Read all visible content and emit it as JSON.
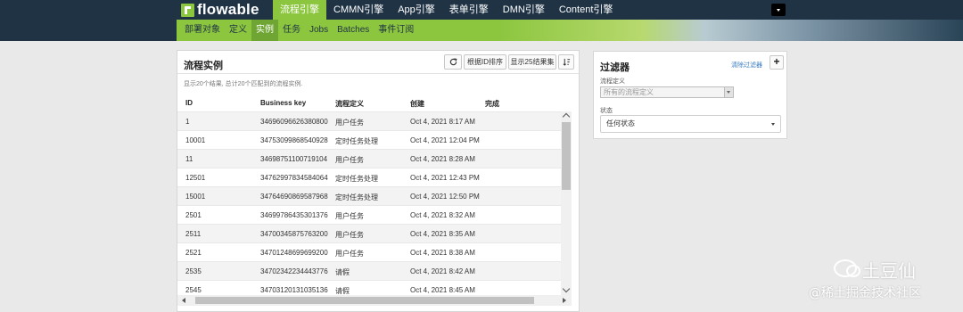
{
  "app": {
    "logo_text": "flowable"
  },
  "topnav": {
    "tabs": [
      {
        "label": "流程引擎",
        "active": true
      },
      {
        "label": "CMMN引擎",
        "active": false
      },
      {
        "label": "App引擎",
        "active": false
      },
      {
        "label": "表单引擎",
        "active": false
      },
      {
        "label": "DMN引擎",
        "active": false
      },
      {
        "label": "Content引擎",
        "active": false
      }
    ]
  },
  "subnav": {
    "tabs": [
      {
        "label": "部署对象",
        "active": false
      },
      {
        "label": "定义",
        "active": false
      },
      {
        "label": "实例",
        "active": true
      },
      {
        "label": "任务",
        "active": false
      },
      {
        "label": "Jobs",
        "active": false
      },
      {
        "label": "Batches",
        "active": false
      },
      {
        "label": "事件订阅",
        "active": false
      }
    ]
  },
  "instances": {
    "title": "流程实例",
    "sort_label": "根据ID排序",
    "show_label": "显示25结果集",
    "summary": "显示20个结果, 总计20个匹配到的流程实例.",
    "columns": [
      "ID",
      "Business key",
      "流程定义",
      "创建",
      "完成"
    ],
    "rows": [
      [
        "1",
        "34696096626380800",
        "用户任务",
        "Oct 4, 2021 8:17 AM",
        ""
      ],
      [
        "10001",
        "34753099868540928",
        "定时任务处理",
        "Oct 4, 2021 12:04 PM",
        ""
      ],
      [
        "11",
        "34698751100719104",
        "用户任务",
        "Oct 4, 2021 8:28 AM",
        ""
      ],
      [
        "12501",
        "34762997834584064",
        "定时任务处理",
        "Oct 4, 2021 12:43 PM",
        ""
      ],
      [
        "15001",
        "34764690869587968",
        "定时任务处理",
        "Oct 4, 2021 12:50 PM",
        ""
      ],
      [
        "2501",
        "34699786435301376",
        "用户任务",
        "Oct 4, 2021 8:32 AM",
        ""
      ],
      [
        "2511",
        "34700345875763200",
        "用户任务",
        "Oct 4, 2021 8:35 AM",
        ""
      ],
      [
        "2521",
        "34701248699699200",
        "用户任务",
        "Oct 4, 2021 8:38 AM",
        ""
      ],
      [
        "2535",
        "34702342234443776",
        "请假",
        "Oct 4, 2021 8:42 AM",
        ""
      ],
      [
        "2545",
        "34703120131035136",
        "请假",
        "Oct 4, 2021 8:45 AM",
        ""
      ]
    ]
  },
  "filter": {
    "title": "过滤器",
    "clear_label": "清除过滤器",
    "add_symbol": "+",
    "process_def_label": "流程定义",
    "process_def_value": "所有的流程定义",
    "status_label": "状态",
    "status_value": "任何状态"
  },
  "watermark": {
    "name": "土豆仙",
    "site": "@稀土掘金技术社区"
  },
  "colors": {
    "nav_dark": "#1f3345",
    "nav_green": "#8cc63f",
    "link_blue": "#3a7bbf"
  }
}
